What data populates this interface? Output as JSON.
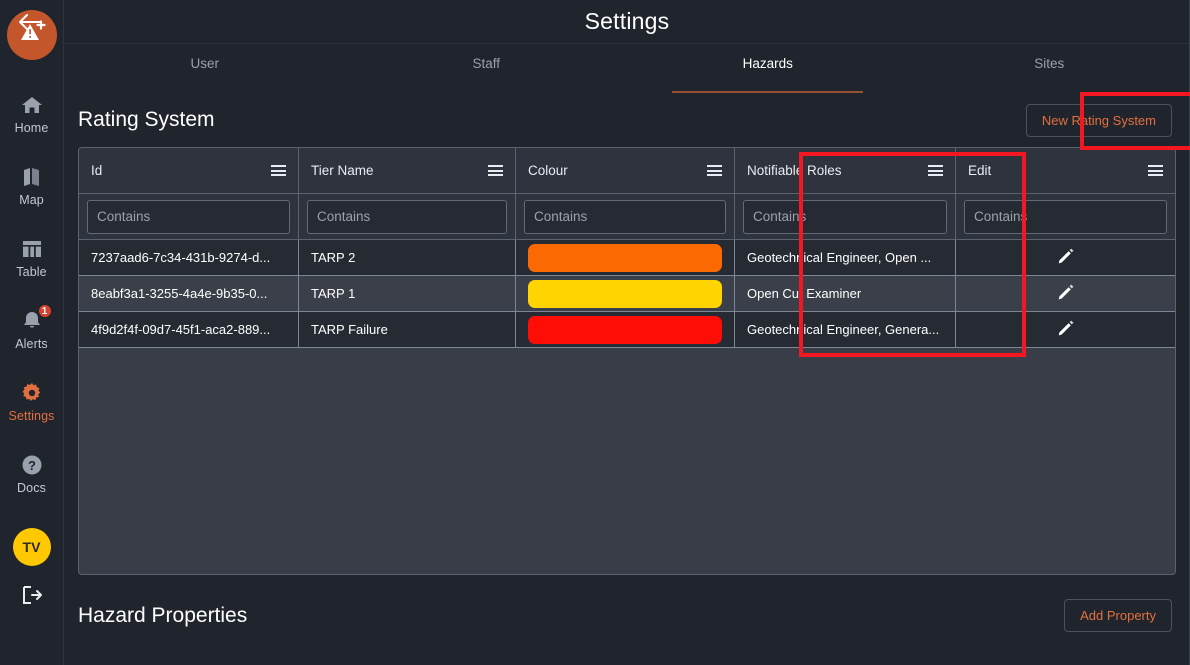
{
  "sidebar": {
    "logo_icon": "warning-triangle-add-icon",
    "items": [
      {
        "label": "Home",
        "icon": "home-icon",
        "active": false,
        "badge": null
      },
      {
        "label": "Map",
        "icon": "map-icon",
        "active": false,
        "badge": null
      },
      {
        "label": "Table",
        "icon": "table-icon",
        "active": false,
        "badge": null
      },
      {
        "label": "Alerts",
        "icon": "bell-icon",
        "active": false,
        "badge": "1"
      },
      {
        "label": "Settings",
        "icon": "gear-icon",
        "active": true,
        "badge": null
      },
      {
        "label": "Docs",
        "icon": "help-icon",
        "active": false,
        "badge": null
      }
    ],
    "avatar_initials": "TV",
    "logout_icon": "logout-icon"
  },
  "header": {
    "title": "Settings",
    "back_icon": "back-arrow-icon"
  },
  "tabs": [
    {
      "label": "User",
      "active": false
    },
    {
      "label": "Staff",
      "active": false
    },
    {
      "label": "Hazards",
      "active": true
    },
    {
      "label": "Sites",
      "active": false
    }
  ],
  "rating_system": {
    "title": "Rating System",
    "new_button_label": "New Rating System",
    "columns": [
      {
        "label": "Id",
        "menu_icon": "hamburger-menu-icon"
      },
      {
        "label": "Tier Name",
        "menu_icon": "hamburger-menu-icon"
      },
      {
        "label": "Colour",
        "menu_icon": "hamburger-menu-icon"
      },
      {
        "label": "Notifiable Roles",
        "menu_icon": "hamburger-menu-icon"
      },
      {
        "label": "Edit",
        "menu_icon": "hamburger-menu-icon"
      }
    ],
    "filter_placeholder": "Contains",
    "filter_values": [
      "",
      "",
      "",
      "",
      ""
    ],
    "rows": [
      {
        "id": "7237aad6-7c34-431b-9274-d...",
        "tier_name": "TARP 2",
        "colour": "#FB6A02",
        "notifiable_roles": "Geotechnical Engineer, Open ...",
        "edit_icon": "pencil-icon"
      },
      {
        "id": "8eabf3a1-3255-4a4e-9b35-0...",
        "tier_name": "TARP 1",
        "colour": "#FFD400",
        "notifiable_roles": "Open Cut Examiner",
        "edit_icon": "pencil-icon"
      },
      {
        "id": "4f9d2f4f-09d7-45f1-aca2-889...",
        "tier_name": "TARP Failure",
        "colour": "#FF0D06",
        "notifiable_roles": "Geotechnical Engineer, Genera...",
        "edit_icon": "pencil-icon"
      }
    ]
  },
  "hazard_properties": {
    "title": "Hazard Properties",
    "add_button_label": "Add Property"
  },
  "annotations": {
    "color": "#f31721",
    "targets": [
      "new-rating-system-button",
      "notifiable-roles-column"
    ]
  },
  "colors": {
    "accent": "#e2703f",
    "page_bg": "#20242c",
    "panel_bg": "#383d47",
    "header_bg": "#2e333d",
    "badge": "#d9412f",
    "avatar": "#ffc800"
  }
}
